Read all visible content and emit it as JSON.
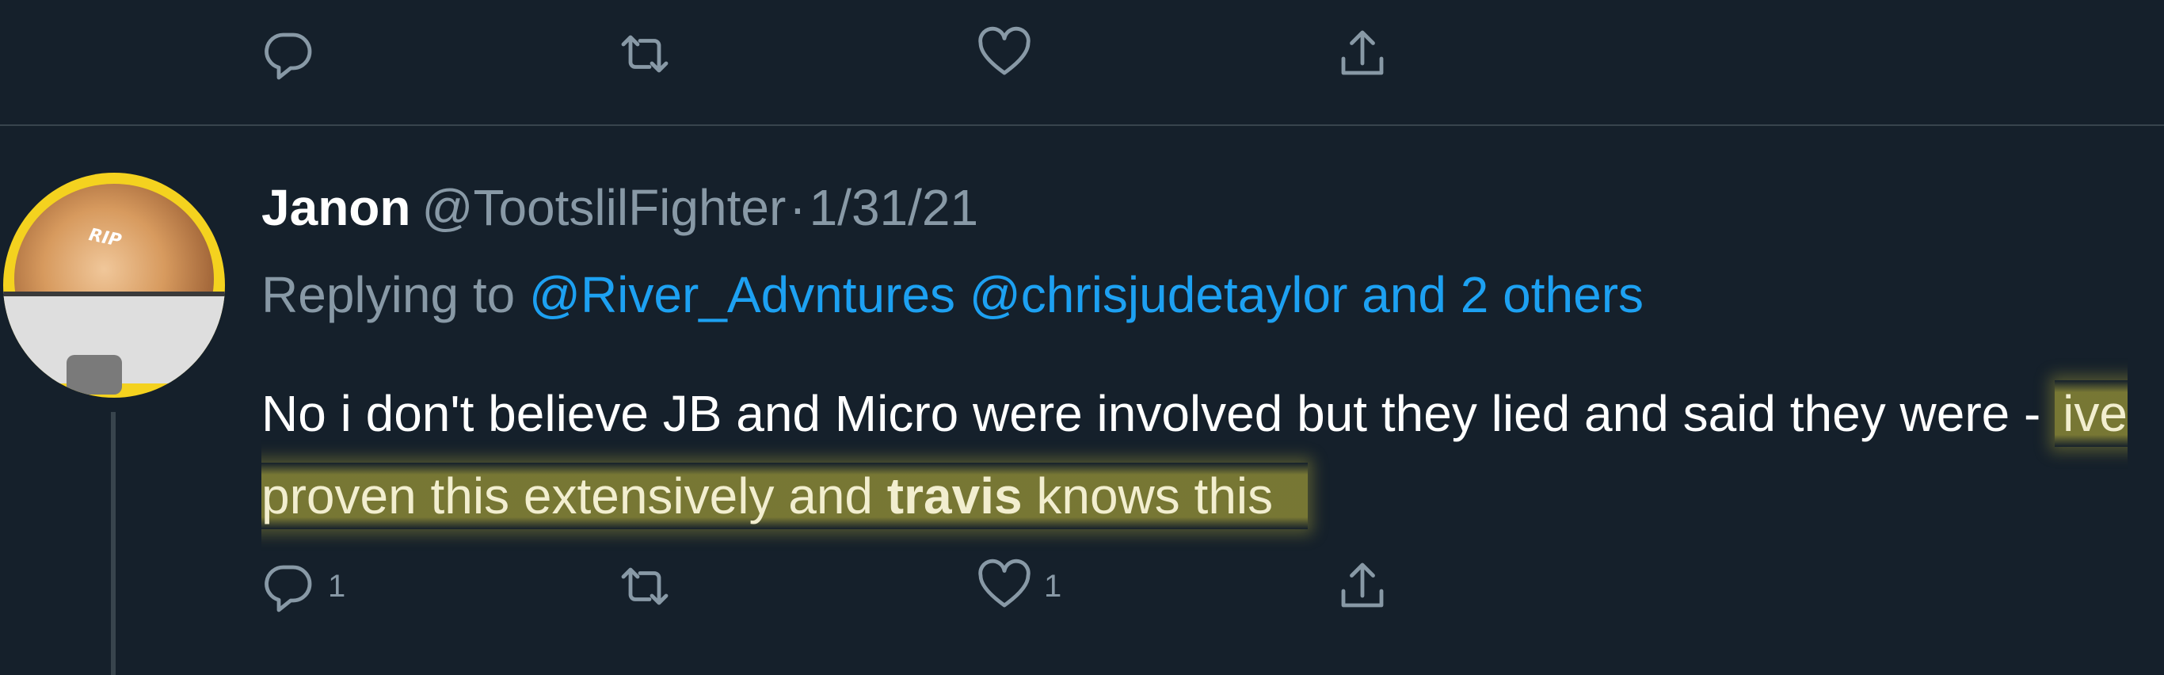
{
  "previous_tweet": {
    "actions": {
      "reply_count": "",
      "retweet_count": "",
      "like_count": "",
      "share_count": ""
    }
  },
  "tweet": {
    "display_name": "Janon",
    "handle": "@TootslilFighter",
    "separator": "·",
    "date": "1/31/21",
    "replying_prefix": "Replying to",
    "replying_to": [
      "@River_Advntures",
      "@chrisjudetaylor"
    ],
    "replying_others": "and 2 others",
    "body_plain": "No i don't believe JB and Micro were involved but they lied and said they were -",
    "body_highlight_before": "ive proven this extensively and",
    "body_highlight_bold": "travis",
    "body_highlight_after": "knows this",
    "avatar_text": "RIP",
    "actions": {
      "reply_count": "1",
      "retweet_count": "",
      "like_count": "1",
      "share_count": ""
    }
  },
  "icons": {
    "reply": "reply-icon",
    "retweet": "retweet-icon",
    "like": "heart-icon",
    "share": "share-icon"
  },
  "colors": {
    "background": "#15202b",
    "text": "#ffffff",
    "secondary": "#8899a6",
    "link": "#1da1f2",
    "divider": "#38444d",
    "highlight": "#c8be3c"
  }
}
